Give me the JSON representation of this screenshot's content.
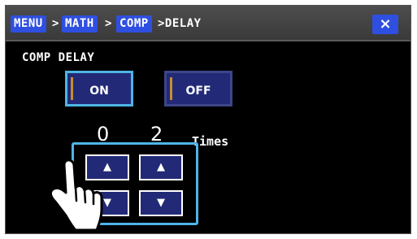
{
  "titlebar": {
    "breadcrumbs": [
      "MENU",
      "MATH",
      "COMP"
    ],
    "separator": ">",
    "current": ">DELAY",
    "close_label": "×"
  },
  "panel": {
    "heading": "COMP DELAY",
    "toggle": {
      "on_label": "ON",
      "off_label": "OFF",
      "selected": "ON"
    },
    "delay": {
      "digits": [
        "0",
        "2"
      ],
      "unit": "Times"
    },
    "stepper": {
      "up_glyph": "▲",
      "down_glyph": "▼"
    }
  },
  "icons": {
    "pointer": "hand-pointer-icon"
  },
  "colors": {
    "accent": "#2f4fe0",
    "selection": "#4fb4e6",
    "button": "#222a77"
  }
}
